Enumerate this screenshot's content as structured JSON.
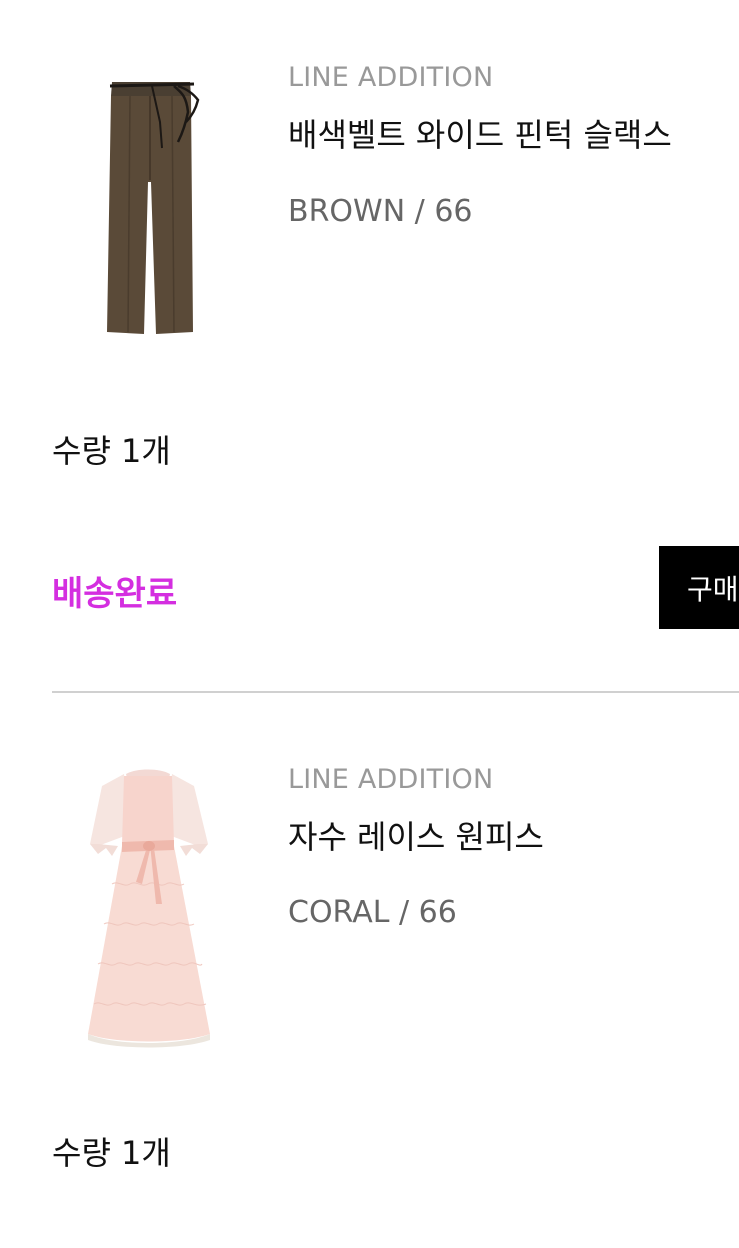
{
  "colors": {
    "delivered_status": "#d42ee0",
    "divider": "#d0d0d0",
    "button_bg": "#000000"
  },
  "orders": [
    {
      "brand": "LINE ADDITION",
      "name": "배색벨트 와이드 핀턱 슬랙스",
      "option": "BROWN / 66",
      "quantity": "수량 1개",
      "image_icon": "brown-wide-slacks-image",
      "status": "배송완료",
      "button_label": "구매"
    },
    {
      "brand": "LINE ADDITION",
      "name": "자수 레이스 원피스",
      "option": "CORAL / 66",
      "quantity": "수량 1개",
      "image_icon": "coral-lace-dress-image"
    }
  ]
}
